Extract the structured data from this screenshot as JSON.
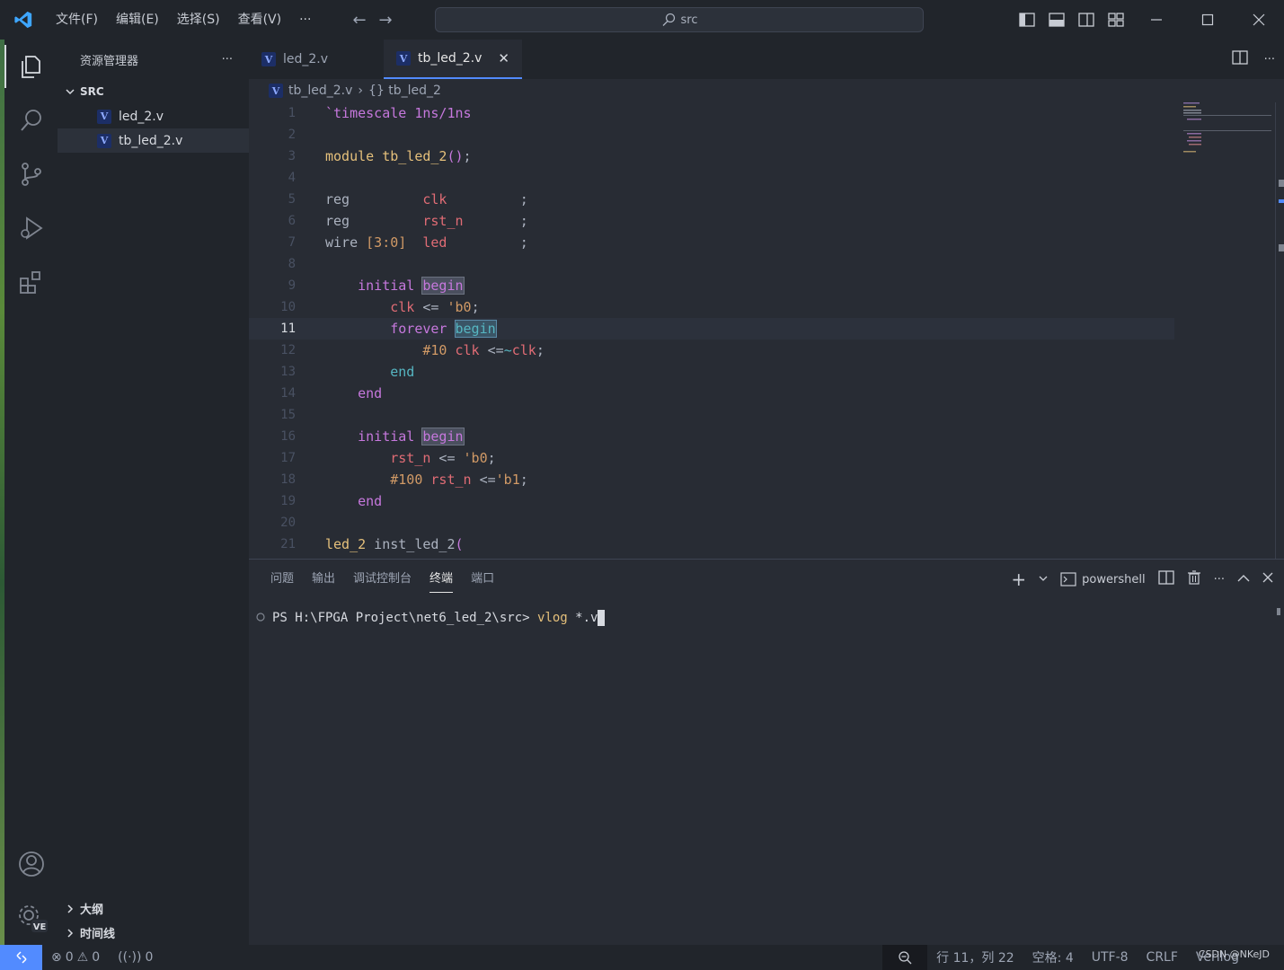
{
  "menu": {
    "file": "文件(F)",
    "edit": "编辑(E)",
    "selection": "选择(S)",
    "view": "查看(V)",
    "more": "···"
  },
  "search": {
    "text": "src"
  },
  "sidebar": {
    "title": "资源管理器",
    "more": "···",
    "section": "SRC",
    "files": [
      "led_2.v",
      "tb_led_2.v"
    ],
    "bottom": {
      "outline": "大纲",
      "timeline": "时间线"
    }
  },
  "tabs": [
    {
      "label": "led_2.v"
    },
    {
      "label": "tb_led_2.v",
      "close": "✕"
    }
  ],
  "breadcrumb": {
    "file": "tb_led_2.v",
    "symbol": "{} tb_led_2"
  },
  "editor": {
    "current_line": 11,
    "line_numbers": [
      "1",
      "2",
      "3",
      "4",
      "5",
      "6",
      "7",
      "8",
      "9",
      "10",
      "11",
      "12",
      "13",
      "14",
      "15",
      "16",
      "17",
      "18",
      "19",
      "20",
      "21"
    ]
  },
  "panel": {
    "tabs": [
      "问题",
      "输出",
      "调试控制台",
      "终端",
      "端口"
    ],
    "active_tab": "终端",
    "shell": "powershell",
    "prompt": "PS H:\\FPGA Project\\net6_led_2\\src>",
    "command": "vlog",
    "args": "*.v"
  },
  "status": {
    "errors": "0",
    "warnings": "0",
    "ports": "0",
    "position": "行 11，列 22",
    "spaces": "空格: 4",
    "encoding": "UTF-8",
    "eol": "CRLF",
    "language": "Verilog",
    "watermark": "CSDN @NKeJD"
  },
  "colors": {
    "accent": "#528bff",
    "bg": "#282c34",
    "chrome": "#21252b"
  }
}
